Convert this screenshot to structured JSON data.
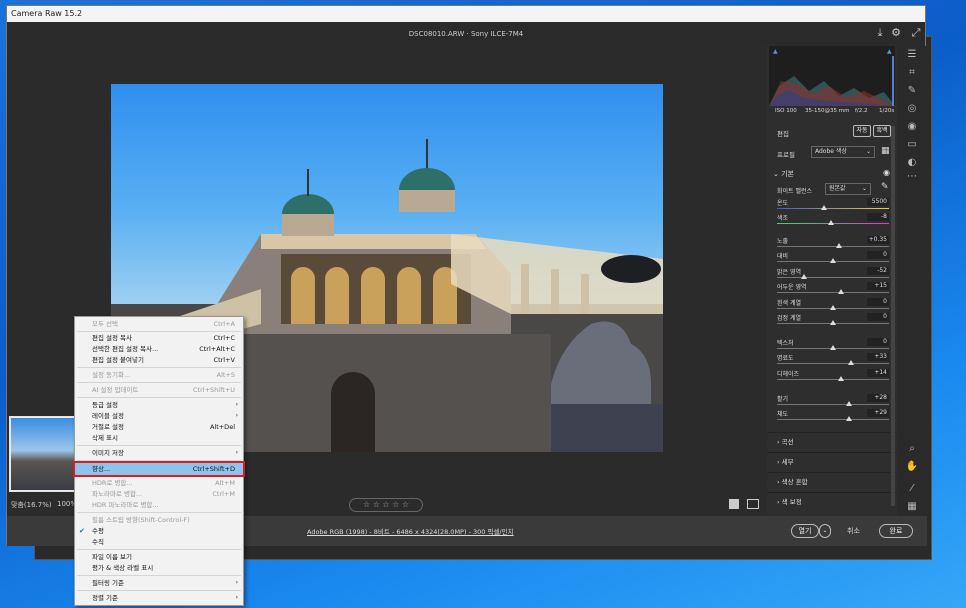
{
  "app": {
    "title": "Camera Raw 15.2",
    "file_info": "DSC08010.ARW  ·  Sony ILCE-7M4"
  },
  "histogram": {
    "info": [
      "ISO 100",
      "35-150@35 mm",
      "f/2.2",
      "1/20s"
    ]
  },
  "panel": {
    "edit_label": "편집",
    "auto_button": "자동",
    "bw_button": "흑백",
    "profile_label": "프로필",
    "profile_value": "Adobe 색상",
    "basic_section": "기본",
    "wb_label": "화이트 밸런스",
    "wb_value": "원본값",
    "sliders": [
      {
        "label": "온도",
        "value": "5500",
        "pos": 0.42
      },
      {
        "label": "색조",
        "value": "-8",
        "pos": 0.48
      },
      {
        "label": "노출",
        "value": "+0.35",
        "pos": 0.55
      },
      {
        "label": "대비",
        "value": "0",
        "pos": 0.5
      },
      {
        "label": "밝은 영역",
        "value": "-52",
        "pos": 0.24
      },
      {
        "label": "어두운 영역",
        "value": "+15",
        "pos": 0.57
      },
      {
        "label": "흰색 계열",
        "value": "0",
        "pos": 0.5
      },
      {
        "label": "검정 계열",
        "value": "0",
        "pos": 0.5
      },
      {
        "label": "텍스처",
        "value": "0",
        "pos": 0.5
      },
      {
        "label": "명료도",
        "value": "+33",
        "pos": 0.66
      },
      {
        "label": "디헤이즈",
        "value": "+14",
        "pos": 0.57
      },
      {
        "label": "활기",
        "value": "+28",
        "pos": 0.64
      },
      {
        "label": "채도",
        "value": "+29",
        "pos": 0.64
      }
    ],
    "sections": [
      "곡선",
      "세부",
      "색상 혼합",
      "색 보정"
    ]
  },
  "bottom": {
    "zoom_value": "맞춤(16.7%)",
    "zoom_100": "100%",
    "rating_stars": "☆ ☆ ☆ ☆ ☆",
    "workflow_link": "Adobe RGB (1998) - 8비트 - 6486 x 4324(28.0MP) - 300 픽셀/인치",
    "open_button": "열기",
    "cancel_button": "취소",
    "done_button": "완료"
  },
  "context_menu": {
    "items": [
      {
        "label": "모두 선택",
        "shortcut": "Ctrl+A",
        "disabled": true
      },
      {
        "label": "편집 설정 복사",
        "shortcut": "Ctrl+C",
        "disabled": false
      },
      {
        "label": "선택한 편집 설정 복사...",
        "shortcut": "Ctrl+Alt+C",
        "disabled": false
      },
      {
        "label": "편집 설정 붙여넣기",
        "shortcut": "Ctrl+V",
        "disabled": false
      },
      {
        "label": "설정 동기화...",
        "shortcut": "Alt+S",
        "disabled": true
      },
      {
        "label": "AI 설정 업데이트",
        "shortcut": "Ctrl+Shift+U",
        "disabled": true
      },
      {
        "label": "등급 설정",
        "shortcut": "",
        "disabled": false,
        "submenu": true
      },
      {
        "label": "레이블 설정",
        "shortcut": "",
        "disabled": false,
        "submenu": true
      },
      {
        "label": "거절로 설정",
        "shortcut": "Alt+Del",
        "disabled": false
      },
      {
        "label": "삭제 표시",
        "shortcut": "",
        "disabled": false
      },
      {
        "label": "이미지 저장",
        "shortcut": "",
        "disabled": false,
        "submenu": true
      },
      {
        "label": "향상...",
        "shortcut": "Ctrl+Shift+D",
        "disabled": false,
        "highlighted": true
      },
      {
        "label": "HDR로 병합...",
        "shortcut": "Alt+M",
        "disabled": true
      },
      {
        "label": "파노라마로 병합...",
        "shortcut": "Ctrl+M",
        "disabled": true
      },
      {
        "label": "HDR 파노라마로 병합...",
        "shortcut": "",
        "disabled": true
      },
      {
        "label": "필름 스트립 방향(Shift-Control-F)",
        "shortcut": "",
        "disabled": true
      },
      {
        "label": "수평",
        "shortcut": "",
        "disabled": false,
        "checked": true
      },
      {
        "label": "수직",
        "shortcut": "",
        "disabled": false
      },
      {
        "label": "파일 이름 보기",
        "shortcut": "",
        "disabled": false
      },
      {
        "label": "평가 & 색상 라벨 표시",
        "shortcut": "",
        "disabled": false
      },
      {
        "label": "필터링 기준",
        "shortcut": "",
        "disabled": false,
        "submenu": true
      },
      {
        "label": "정렬 기준",
        "shortcut": "",
        "disabled": false,
        "submenu": true
      }
    ]
  }
}
